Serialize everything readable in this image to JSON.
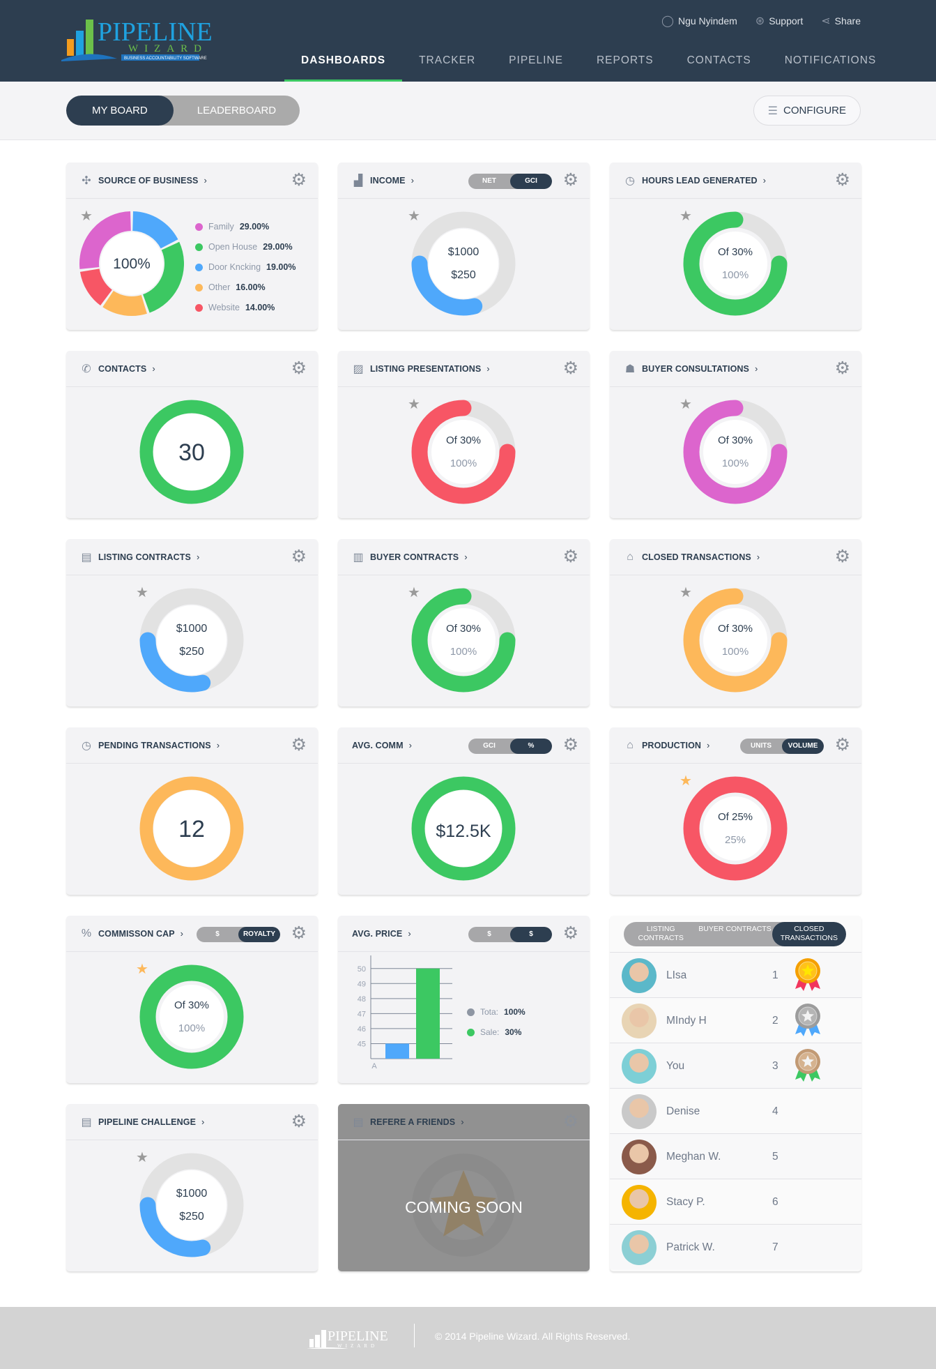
{
  "brand": {
    "name": "PIPELINE",
    "sub": "WIZARD",
    "tagline": "BUSINESS ACCOUNTABILITY SOFTWARE"
  },
  "toplinks": [
    {
      "icon": "user-icon",
      "label": "Ngu Nyindem"
    },
    {
      "icon": "lifebuoy-icon",
      "label": "Support"
    },
    {
      "icon": "share-icon",
      "label": "Share"
    }
  ],
  "nav": [
    {
      "label": "DASHBOARDS",
      "active": true
    },
    {
      "label": "TRACKER"
    },
    {
      "label": "PIPELINE"
    },
    {
      "label": "REPORTS"
    },
    {
      "label": "CONTACTS"
    },
    {
      "label": "NOTIFICATIONS"
    }
  ],
  "board_toggle": {
    "options": [
      "MY BOARD",
      "LEADERBOARD"
    ],
    "active": 0
  },
  "configure_label": "CONFIGURE",
  "colors": {
    "navy": "#2d3e50",
    "green": "#3cc862",
    "blue": "#4fa8fb",
    "red": "#f75665",
    "orange": "#fdb85a",
    "pink": "#dc65cd",
    "gray": "#e2e2e2"
  },
  "cards": [
    {
      "id": "source-of-business",
      "title": "SOURCE OF BUSINESS",
      "icon": "network-icon",
      "star": "gray",
      "widget": {
        "type": "pie",
        "center": "100%",
        "segments": [
          {
            "label": "Door Kncking",
            "value": "19.00%",
            "pct": 19,
            "color": "#4fa8fb"
          },
          {
            "label": "Open House",
            "value": "29.00%",
            "pct": 29,
            "color": "#3cc862"
          },
          {
            "label": "Other",
            "value": "16.00%",
            "pct": 16,
            "color": "#fdb85a"
          },
          {
            "label": "Website",
            "value": "14.00%",
            "pct": 14,
            "color": "#f75665"
          },
          {
            "label": "Family",
            "value": "29.00%",
            "pct": 29,
            "color": "#dc65cd"
          }
        ],
        "legend_order": [
          4,
          1,
          0,
          2,
          3
        ]
      }
    },
    {
      "id": "income",
      "title": "INCOME",
      "icon": "bar-chart-icon",
      "star": "gray",
      "toggle": {
        "options": [
          "NET",
          "GCI"
        ],
        "active": 1
      },
      "widget": {
        "type": "money",
        "fill": 0.29,
        "color": "#4fa8fb",
        "lines": [
          "$1000",
          "$250"
        ]
      }
    },
    {
      "id": "hours-lead-generated",
      "title": "HOURS LEAD GENERATED",
      "icon": "clock-icon",
      "star": "gray",
      "widget": {
        "type": "progress",
        "fill": 0.75,
        "color": "#3cc862",
        "lines": [
          "Of 30%",
          "100%"
        ]
      }
    },
    {
      "id": "contacts",
      "title": "CONTACTS",
      "icon": "phone-icon",
      "widget": {
        "type": "full",
        "color": "#3cc862",
        "lines": [
          "30"
        ]
      }
    },
    {
      "id": "listing-presentations",
      "title": "LISTING PRESENTATIONS",
      "icon": "presentation-icon",
      "star": "gray",
      "widget": {
        "type": "progress",
        "fill": 0.75,
        "color": "#f75665",
        "lines": [
          "Of 30%",
          "100%"
        ]
      }
    },
    {
      "id": "buyer-consultations",
      "title": "BUYER CONSULTATIONS",
      "icon": "people-icon",
      "star": "gray",
      "widget": {
        "type": "progress",
        "fill": 0.75,
        "color": "#dc65cd",
        "lines": [
          "Of 30%",
          "100%"
        ]
      }
    },
    {
      "id": "listing-contracts",
      "title": "LISTING CONTRACTS",
      "icon": "document-icon",
      "star": "gray",
      "widget": {
        "type": "money",
        "fill": 0.29,
        "color": "#4fa8fb",
        "lines": [
          "$1000",
          "$250"
        ]
      }
    },
    {
      "id": "buyer-contracts",
      "title": "BUYER CONTRACTS",
      "icon": "contract-icon",
      "star": "gray",
      "widget": {
        "type": "progress",
        "fill": 0.75,
        "color": "#3cc862",
        "lines": [
          "Of 30%",
          "100%"
        ]
      }
    },
    {
      "id": "closed-transactions",
      "title": "CLOSED TRANSACTIONS",
      "icon": "bank-icon",
      "star": "gray",
      "widget": {
        "type": "progress",
        "fill": 0.75,
        "color": "#fdb85a",
        "lines": [
          "Of 30%",
          "100%"
        ]
      }
    },
    {
      "id": "pending-transactions",
      "title": "PENDING TRANSACTIONS",
      "icon": "clock-icon",
      "widget": {
        "type": "full",
        "color": "#fdb85a",
        "lines": [
          "12"
        ]
      }
    },
    {
      "id": "avg-comm",
      "title": "AVG. COMM",
      "toggle": {
        "options": [
          "GCI",
          "%"
        ],
        "active": 1
      },
      "widget": {
        "type": "full",
        "color": "#3cc862",
        "lines": [
          "$12.5K"
        ]
      }
    },
    {
      "id": "production",
      "title": "PRODUCTION",
      "icon": "house-icon",
      "star": "orange",
      "toggle": {
        "options": [
          "UNITS",
          "VOLUME"
        ],
        "active": 1
      },
      "widget": {
        "type": "progress",
        "fill": 1,
        "color": "#f75665",
        "lines": [
          "Of 25%",
          "25%"
        ]
      }
    },
    {
      "id": "commission-cap",
      "title": "COMMISSON CAP",
      "icon": "percent-icon",
      "star": "orange",
      "toggle": {
        "options": [
          "$",
          "ROYALTY"
        ],
        "active": 1
      },
      "widget": {
        "type": "progress",
        "fill": 1,
        "color": "#3cc862",
        "lines": [
          "Of 30%",
          "100%"
        ]
      }
    },
    {
      "id": "avg-price",
      "title": "AVG. PRICE",
      "toggle": {
        "options": [
          "$",
          "$"
        ],
        "active": 1
      },
      "widget": {
        "type": "bar"
      }
    },
    {
      "id": "pipeline-challenge",
      "title": "PIPELINE CHALLENGE",
      "icon": "document-icon",
      "star": "gray",
      "widget": {
        "type": "money",
        "fill": 0.29,
        "color": "#4fa8fb",
        "lines": [
          "$1000",
          "$250"
        ]
      }
    },
    {
      "id": "refer-a-friends",
      "title": "REFERE A FRIENDS",
      "icon": "refer-icon",
      "coming_soon": "COMING SOON",
      "widget": {
        "type": "soon"
      }
    }
  ],
  "chart_data": {
    "type": "bar",
    "categories": [
      "A"
    ],
    "series": [
      {
        "values": [
          45
        ],
        "color": "#4fa8fb"
      },
      {
        "values": [
          50
        ],
        "color": "#3cc862"
      }
    ],
    "yticks": [
      45,
      46,
      47,
      48,
      49,
      50
    ],
    "ylim": [
      44,
      50.5
    ],
    "grid": true,
    "legend": [
      {
        "label": "Tota:",
        "value": "100%",
        "color": "#8e96a3"
      },
      {
        "label": "Sale:",
        "value": "30%",
        "color": "#3cc862"
      }
    ],
    "legend_placement": "right"
  },
  "leaderboard": {
    "tabs": [
      "LISTING CONTRACTS",
      "BUYER CONTRACTS",
      "CLOSED TRANSACTIONS"
    ],
    "active": 2,
    "rows": [
      {
        "name": "LIsa",
        "rank": "1",
        "medal": "gold",
        "avatar": "#5bb8c9"
      },
      {
        "name": "MIndy H",
        "rank": "2",
        "medal": "silver",
        "avatar": "#e8d4b4"
      },
      {
        "name": "You",
        "rank": "3",
        "medal": "bronze",
        "avatar": "#7dcfd6"
      },
      {
        "name": "Denise",
        "rank": "4",
        "avatar": "#c9c9c9"
      },
      {
        "name": "Meghan W.",
        "rank": "5",
        "avatar": "#8a5a4a"
      },
      {
        "name": "Stacy P.",
        "rank": "6",
        "avatar": "#f5b400"
      },
      {
        "name": "Patrick W.",
        "rank": "7",
        "avatar": "#8ccfd4"
      }
    ]
  },
  "footer": {
    "copyright": "© 2014 Pipeline Wizard. All Rights Reserved."
  }
}
